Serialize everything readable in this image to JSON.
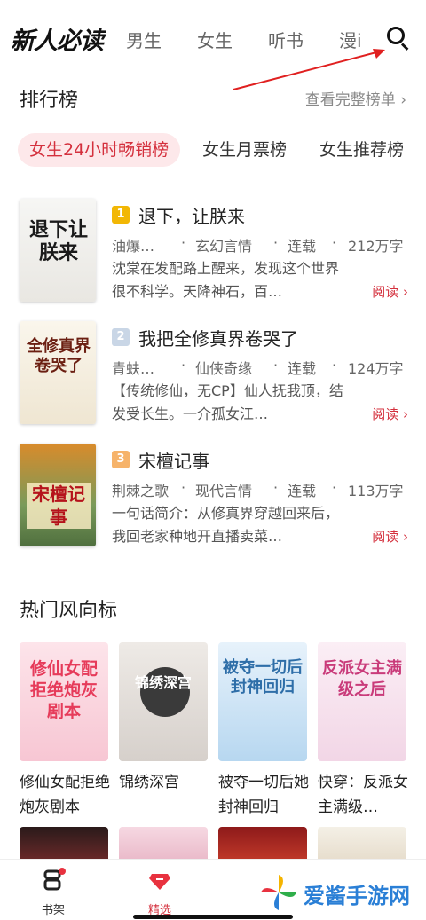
{
  "app": {
    "logo": "新人必读",
    "nav_tabs": [
      "男生",
      "女生",
      "听书",
      "漫i"
    ],
    "colors": {
      "accent": "#d4303d",
      "chip_bg": "#fde8ea"
    }
  },
  "ranking": {
    "title": "排行榜",
    "more": "查看完整榜单 ›",
    "chips": [
      "女生24小时畅销榜",
      "女生月票榜",
      "女生推荐榜"
    ],
    "books": [
      {
        "rank": "1",
        "title": "退下，让朕来",
        "author": "油爆…",
        "genre": "玄幻言情",
        "status": "连载",
        "words": "212万字",
        "desc": "沈棠在发配路上醒来，发现这个世界很不科学。天降神石，百…",
        "read": "阅读 ›",
        "cover_text": "退下让朕来",
        "rank_color": "#f2b705"
      },
      {
        "rank": "2",
        "title": "我把全修真界卷哭了",
        "author": "青蚨…",
        "genre": "仙侠奇缘",
        "status": "连载",
        "words": "124万字",
        "desc": "【传统修仙，无CP】仙人抚我顶，结发受长生。一介孤女江…",
        "read": "阅读 ›",
        "cover_text": "全修真界卷哭了",
        "rank_color": "#9fb4d0"
      },
      {
        "rank": "3",
        "title": "宋檀记事",
        "author": "荆棘之歌",
        "genre": "现代言情",
        "status": "连载",
        "words": "113万字",
        "desc": "一句话简介：从修真界穿越回来后，我回老家种地开直播卖菜…",
        "read": "阅读 ›",
        "cover_text": "宋檀记事",
        "rank_color": "#f0a04b"
      }
    ]
  },
  "hot": {
    "title": "热门风向标",
    "items": [
      {
        "title": "修仙女配拒绝炮灰剧本",
        "cover_text": "修仙女配拒绝炮灰剧本"
      },
      {
        "title": "锦绣深宫",
        "cover_text": "锦绣深宫"
      },
      {
        "title": "被夺一切后她封神回归",
        "cover_text": "被夺一切后封神回归"
      },
      {
        "title": "快穿：反派女主满级…",
        "cover_text": "反派女主满级之后"
      }
    ]
  },
  "bottom_tabs": [
    {
      "label": "书架"
    },
    {
      "label": "精选"
    }
  ],
  "watermark": "爱酱手游网"
}
